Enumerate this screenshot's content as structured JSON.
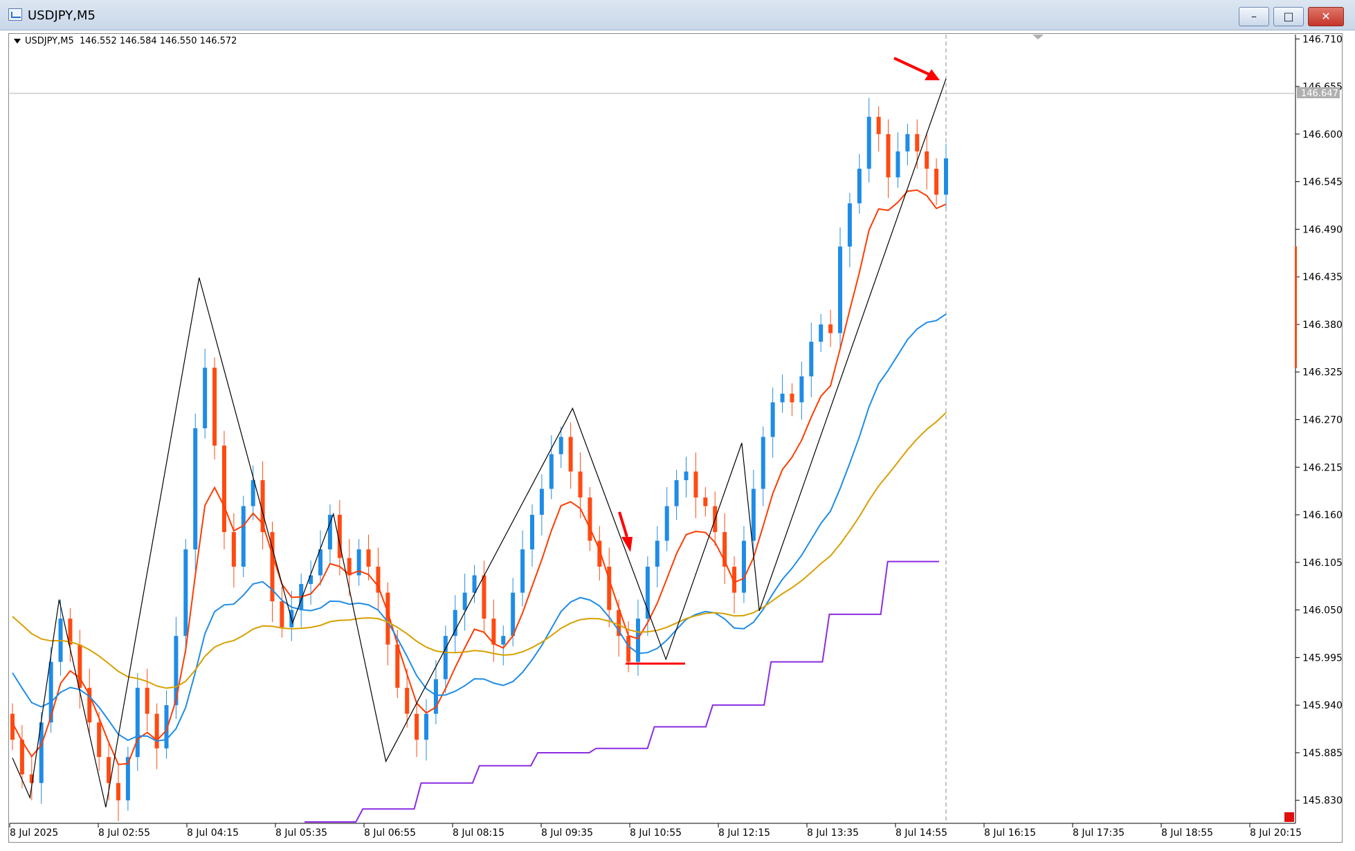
{
  "window": {
    "title": "USDJPY,M5",
    "buttons": {
      "minimize": "–",
      "maximize": "□",
      "close": "✕"
    }
  },
  "info_line": {
    "symbol": "USDJPY,M5",
    "ohlc": "146.552 146.584 146.550 146.572"
  },
  "current_price_label": "146.647",
  "chart_data": {
    "type": "candlestick",
    "symbol": "USDJPY",
    "timeframe": "M5",
    "ylim": [
      145.805,
      146.715
    ],
    "y_ticks": [
      "146.710",
      "146.655",
      "146.600",
      "146.545",
      "146.490",
      "146.435",
      "146.380",
      "146.325",
      "146.270",
      "146.215",
      "146.160",
      "146.105",
      "146.050",
      "145.995",
      "145.940",
      "145.885",
      "145.830"
    ],
    "x_ticks": [
      "8 Jul 2025",
      "8 Jul 02:55",
      "8 Jul 04:15",
      "8 Jul 05:35",
      "8 Jul 06:55",
      "8 Jul 08:15",
      "8 Jul 09:35",
      "8 Jul 10:55",
      "8 Jul 12:15",
      "8 Jul 13:35",
      "8 Jul 14:55",
      "8 Jul 16:15",
      "8 Jul 17:35",
      "8 Jul 18:55",
      "8 Jul 20:15"
    ],
    "last_close": 146.647,
    "zigzag": [
      {
        "time": "01:35",
        "price": 145.879
      },
      {
        "time": "01:50",
        "price": 145.833
      },
      {
        "time": "02:15",
        "price": 146.062
      },
      {
        "time": "02:55",
        "price": 145.822
      },
      {
        "time": "04:15",
        "price": 146.434
      },
      {
        "time": "05:35",
        "price": 146.035
      },
      {
        "time": "06:10",
        "price": 146.161
      },
      {
        "time": "06:55",
        "price": 145.875
      },
      {
        "time": "09:35",
        "price": 146.283
      },
      {
        "time": "10:55",
        "price": 145.993
      },
      {
        "time": "12:00",
        "price": 146.243
      },
      {
        "time": "12:15",
        "price": 146.049
      },
      {
        "time": "14:55",
        "price": 146.664
      }
    ],
    "candles_close": [
      145.9,
      145.86,
      145.85,
      145.92,
      145.99,
      146.04,
      146.01,
      145.96,
      145.92,
      145.88,
      145.85,
      145.83,
      145.88,
      145.96,
      145.93,
      145.89,
      145.94,
      146.02,
      146.12,
      146.26,
      146.33,
      146.24,
      146.14,
      146.1,
      146.17,
      146.2,
      146.14,
      146.06,
      146.03,
      146.05,
      146.08,
      146.09,
      146.12,
      146.16,
      146.11,
      146.09,
      146.12,
      146.1,
      146.07,
      146.01,
      145.96,
      145.93,
      145.9,
      145.93,
      145.97,
      146.02,
      146.05,
      146.07,
      146.09,
      146.04,
      146.01,
      146.02,
      146.07,
      146.12,
      146.16,
      146.19,
      146.23,
      146.25,
      146.21,
      146.18,
      146.13,
      146.1,
      146.05,
      146.02,
      145.99,
      146.04,
      146.1,
      146.13,
      146.17,
      146.2,
      146.21,
      146.18,
      146.17,
      146.14,
      146.1,
      146.07,
      146.13,
      146.19,
      146.25,
      146.29,
      146.3,
      146.29,
      146.32,
      146.36,
      146.38,
      146.37,
      146.47,
      146.52,
      146.56,
      146.62,
      146.6,
      146.55,
      146.58,
      146.6,
      146.58,
      146.56,
      146.53,
      146.572
    ],
    "moving_averages": [
      {
        "color": "#ff3b00",
        "period": "fast",
        "values_end": 146.519
      },
      {
        "color": "#1f8ce6",
        "period": "medium",
        "values_end": 146.392
      },
      {
        "color": "#d8a000",
        "period": "slow",
        "values_end": 146.278
      }
    ],
    "step_line": {
      "color": "#8b2be2",
      "levels": [
        145.805,
        145.82,
        145.85,
        145.87,
        145.885,
        145.89,
        145.915,
        145.94,
        145.99,
        146.045,
        146.106
      ]
    },
    "annotations": [
      {
        "type": "arrow",
        "color": "#ff0000",
        "target": "latest high"
      },
      {
        "type": "arrow",
        "color": "#ff0000",
        "target": "10:55 low"
      },
      {
        "type": "horizontal_line",
        "color": "#ff0000",
        "price": 145.988
      }
    ],
    "colors": {
      "bull": "#1f8ce6",
      "bear": "#ff4a12",
      "grid": "#c0c0c0",
      "zigzag": "#000000"
    }
  }
}
